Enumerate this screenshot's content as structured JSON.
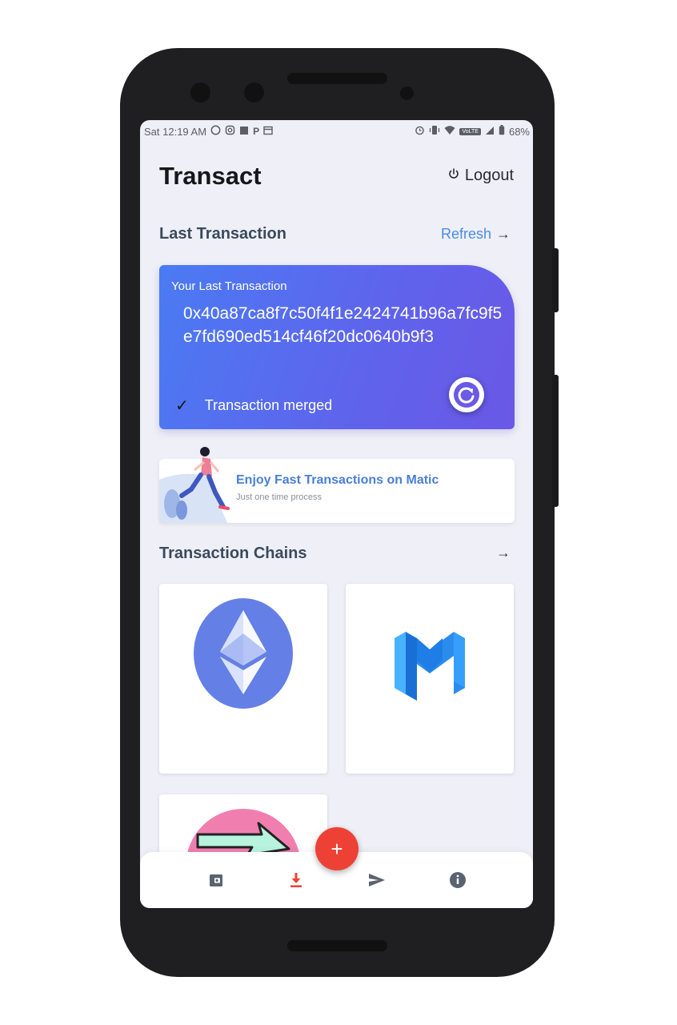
{
  "status_bar": {
    "time": "Sat 12:19 AM",
    "network_badge": "VoLTE",
    "battery": "68%"
  },
  "header": {
    "title": "Transact",
    "logout_label": "Logout"
  },
  "last_transaction": {
    "section_title": "Last Transaction",
    "refresh_label": "Refresh",
    "card_label": "Your Last Transaction",
    "hash": "0x40a87ca8f7c50f4f1e2424741b96a7fc9f5e7fd690ed514cf46f20dc0640b9f3",
    "status": "Transaction merged"
  },
  "promo": {
    "title": "Enjoy Fast Transactions on Matic",
    "subtitle": "Just one time process"
  },
  "chains": {
    "section_title": "Transaction Chains",
    "items": [
      "ethereum-logo",
      "matic-logo",
      "arrow-logo"
    ]
  },
  "bottom_nav": {
    "items": [
      "wallet-icon",
      "download-icon",
      "send-icon",
      "info-icon"
    ],
    "active": "download-icon",
    "fab_label": "+"
  },
  "colors": {
    "accent": "#4a7bf3",
    "card_gradient_end": "#6a58e6",
    "fab": "#ee4136",
    "link": "#4a8be6",
    "ethereum": "#6480e6"
  }
}
